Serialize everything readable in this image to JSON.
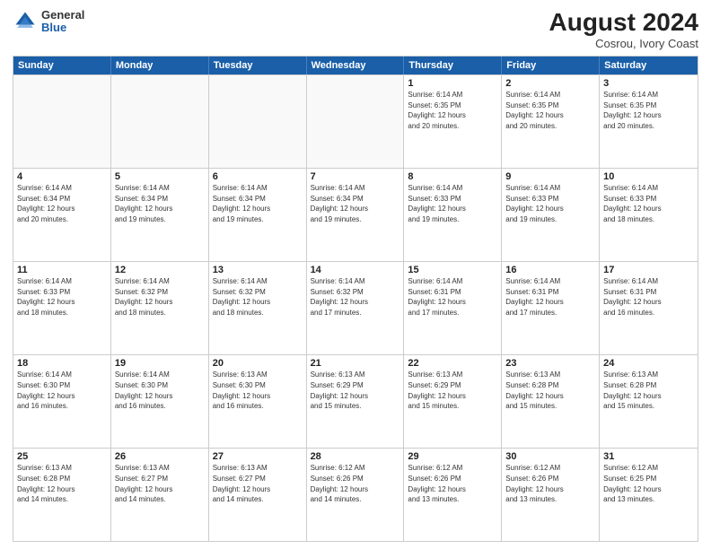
{
  "header": {
    "logo_general": "General",
    "logo_blue": "Blue",
    "month_year": "August 2024",
    "location": "Cosrou, Ivory Coast"
  },
  "days_of_week": [
    "Sunday",
    "Monday",
    "Tuesday",
    "Wednesday",
    "Thursday",
    "Friday",
    "Saturday"
  ],
  "weeks": [
    [
      {
        "day": "",
        "text": ""
      },
      {
        "day": "",
        "text": ""
      },
      {
        "day": "",
        "text": ""
      },
      {
        "day": "",
        "text": ""
      },
      {
        "day": "1",
        "text": "Sunrise: 6:14 AM\nSunset: 6:35 PM\nDaylight: 12 hours\nand 20 minutes."
      },
      {
        "day": "2",
        "text": "Sunrise: 6:14 AM\nSunset: 6:35 PM\nDaylight: 12 hours\nand 20 minutes."
      },
      {
        "day": "3",
        "text": "Sunrise: 6:14 AM\nSunset: 6:35 PM\nDaylight: 12 hours\nand 20 minutes."
      }
    ],
    [
      {
        "day": "4",
        "text": "Sunrise: 6:14 AM\nSunset: 6:34 PM\nDaylight: 12 hours\nand 20 minutes."
      },
      {
        "day": "5",
        "text": "Sunrise: 6:14 AM\nSunset: 6:34 PM\nDaylight: 12 hours\nand 19 minutes."
      },
      {
        "day": "6",
        "text": "Sunrise: 6:14 AM\nSunset: 6:34 PM\nDaylight: 12 hours\nand 19 minutes."
      },
      {
        "day": "7",
        "text": "Sunrise: 6:14 AM\nSunset: 6:34 PM\nDaylight: 12 hours\nand 19 minutes."
      },
      {
        "day": "8",
        "text": "Sunrise: 6:14 AM\nSunset: 6:33 PM\nDaylight: 12 hours\nand 19 minutes."
      },
      {
        "day": "9",
        "text": "Sunrise: 6:14 AM\nSunset: 6:33 PM\nDaylight: 12 hours\nand 19 minutes."
      },
      {
        "day": "10",
        "text": "Sunrise: 6:14 AM\nSunset: 6:33 PM\nDaylight: 12 hours\nand 18 minutes."
      }
    ],
    [
      {
        "day": "11",
        "text": "Sunrise: 6:14 AM\nSunset: 6:33 PM\nDaylight: 12 hours\nand 18 minutes."
      },
      {
        "day": "12",
        "text": "Sunrise: 6:14 AM\nSunset: 6:32 PM\nDaylight: 12 hours\nand 18 minutes."
      },
      {
        "day": "13",
        "text": "Sunrise: 6:14 AM\nSunset: 6:32 PM\nDaylight: 12 hours\nand 18 minutes."
      },
      {
        "day": "14",
        "text": "Sunrise: 6:14 AM\nSunset: 6:32 PM\nDaylight: 12 hours\nand 17 minutes."
      },
      {
        "day": "15",
        "text": "Sunrise: 6:14 AM\nSunset: 6:31 PM\nDaylight: 12 hours\nand 17 minutes."
      },
      {
        "day": "16",
        "text": "Sunrise: 6:14 AM\nSunset: 6:31 PM\nDaylight: 12 hours\nand 17 minutes."
      },
      {
        "day": "17",
        "text": "Sunrise: 6:14 AM\nSunset: 6:31 PM\nDaylight: 12 hours\nand 16 minutes."
      }
    ],
    [
      {
        "day": "18",
        "text": "Sunrise: 6:14 AM\nSunset: 6:30 PM\nDaylight: 12 hours\nand 16 minutes."
      },
      {
        "day": "19",
        "text": "Sunrise: 6:14 AM\nSunset: 6:30 PM\nDaylight: 12 hours\nand 16 minutes."
      },
      {
        "day": "20",
        "text": "Sunrise: 6:13 AM\nSunset: 6:30 PM\nDaylight: 12 hours\nand 16 minutes."
      },
      {
        "day": "21",
        "text": "Sunrise: 6:13 AM\nSunset: 6:29 PM\nDaylight: 12 hours\nand 15 minutes."
      },
      {
        "day": "22",
        "text": "Sunrise: 6:13 AM\nSunset: 6:29 PM\nDaylight: 12 hours\nand 15 minutes."
      },
      {
        "day": "23",
        "text": "Sunrise: 6:13 AM\nSunset: 6:28 PM\nDaylight: 12 hours\nand 15 minutes."
      },
      {
        "day": "24",
        "text": "Sunrise: 6:13 AM\nSunset: 6:28 PM\nDaylight: 12 hours\nand 15 minutes."
      }
    ],
    [
      {
        "day": "25",
        "text": "Sunrise: 6:13 AM\nSunset: 6:28 PM\nDaylight: 12 hours\nand 14 minutes."
      },
      {
        "day": "26",
        "text": "Sunrise: 6:13 AM\nSunset: 6:27 PM\nDaylight: 12 hours\nand 14 minutes."
      },
      {
        "day": "27",
        "text": "Sunrise: 6:13 AM\nSunset: 6:27 PM\nDaylight: 12 hours\nand 14 minutes."
      },
      {
        "day": "28",
        "text": "Sunrise: 6:12 AM\nSunset: 6:26 PM\nDaylight: 12 hours\nand 14 minutes."
      },
      {
        "day": "29",
        "text": "Sunrise: 6:12 AM\nSunset: 6:26 PM\nDaylight: 12 hours\nand 13 minutes."
      },
      {
        "day": "30",
        "text": "Sunrise: 6:12 AM\nSunset: 6:26 PM\nDaylight: 12 hours\nand 13 minutes."
      },
      {
        "day": "31",
        "text": "Sunrise: 6:12 AM\nSunset: 6:25 PM\nDaylight: 12 hours\nand 13 minutes."
      }
    ]
  ]
}
